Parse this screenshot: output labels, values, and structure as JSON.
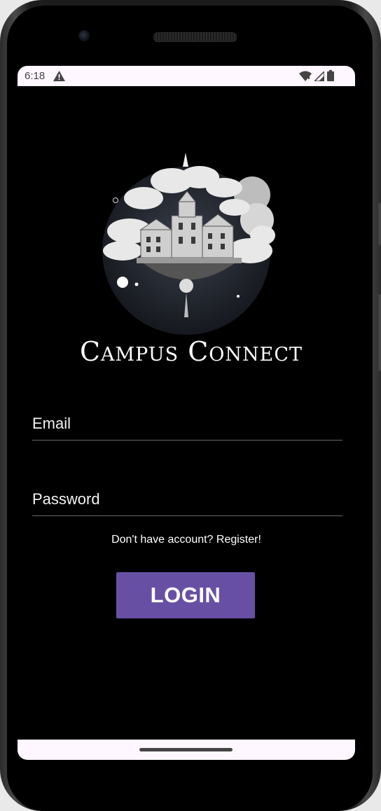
{
  "status_bar": {
    "time": "6:18",
    "warning_icon": "warning-icon",
    "wifi_icon": "wifi-icon",
    "signal_icon": "signal-icon",
    "battery_icon": "battery-icon"
  },
  "app": {
    "logo_icon": "campus-logo",
    "title": "Campus Connect"
  },
  "form": {
    "email_placeholder": "Email",
    "password_placeholder": "Password",
    "register_link": "Don't have account? Register!",
    "login_label": "LOGIN"
  },
  "colors": {
    "accent": "#6750a4",
    "background": "#000000",
    "system_bar": "#fef7ff"
  }
}
